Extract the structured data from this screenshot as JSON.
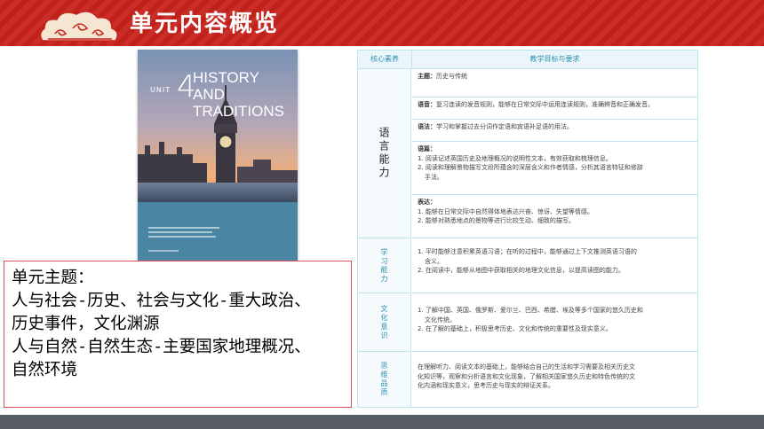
{
  "header": {
    "title": "单元内容概览",
    "decor_icon": "auspicious-cloud-icon",
    "color": "#c8221c"
  },
  "book": {
    "unit_label": "UNIT",
    "unit_number": "4",
    "unit_title": "HISTORY AND TRADITIONS",
    "image": "big-ben-westminster-sunset"
  },
  "theme_box": {
    "lines": [
      "单元主题：",
      "人与社会-历史、社会与文化-重大政治、",
      "历史事件，文化渊源",
      "人与自然-自然生态-主要国家地理概况、",
      "自然环境"
    ]
  },
  "table": {
    "headers": [
      "核心素养",
      "教学目标与要求"
    ],
    "categories": {
      "language": "语言能力",
      "learning": "学习能力",
      "culture": "文化意识",
      "thinking": "思维品质"
    },
    "rows": {
      "theme": {
        "lead": "主题：",
        "text": "历史与传统"
      },
      "phonetics": {
        "lead": "语音：",
        "text": "复习连读的发音规则，能够在日常交际中运用连读规则，准确辨音和正确发音。"
      },
      "grammar": {
        "lead": "语法：",
        "text": "学习和掌握过去分词作定语和宾语补足语的用法。"
      },
      "discourse": {
        "lead": "语篇：",
        "l1": "1. 阅读记述英国历史及地理概况的说明性文本，有效获取和梳理信息。",
        "l2": "2. 阅读和理解景物描写文段所蕴含的深层含义和作者情感，分析其语言特征和修辞",
        "l3": "手法。"
      },
      "expression": {
        "lead": "表达：",
        "l1": "1. 能够在日常交际中自然得体地表达兴奋、惊讶、失望等情感。",
        "l2": "2. 能够对熟悉地点的景物等进行比较生动、细致的描写。"
      },
      "learning": {
        "l1": "1. 平时能够注意积累英语习语；在听的过程中，能够通过上下文推测英语习语的",
        "l2": "含义。",
        "l3": "2. 在阅读中，能够从地图中获取相关的地理文化信息，以提高读图的能力。"
      },
      "culture": {
        "l1": "1. 了解中国、英国、俄罗斯、爱尔兰、巴西、希腊、埃及等多个国家的悠久历史和",
        "l2": "文化传统。",
        "l3": "2. 在了解的基础上，积极思考历史、文化和传统的重要性及现实意义。"
      },
      "thinking": {
        "l1": "在理解听力、阅读文本的基础上，能够结合自己的生活和学习需要及相关历史文",
        "l2": "化知识等，观察和分析语言和文化现象，了解相关国家悠久历史和特色传统的文",
        "l3": "化内涵和现实意义，思考历史与现实的辩证关系。"
      }
    }
  },
  "bottom_bar_color": "#595d64"
}
